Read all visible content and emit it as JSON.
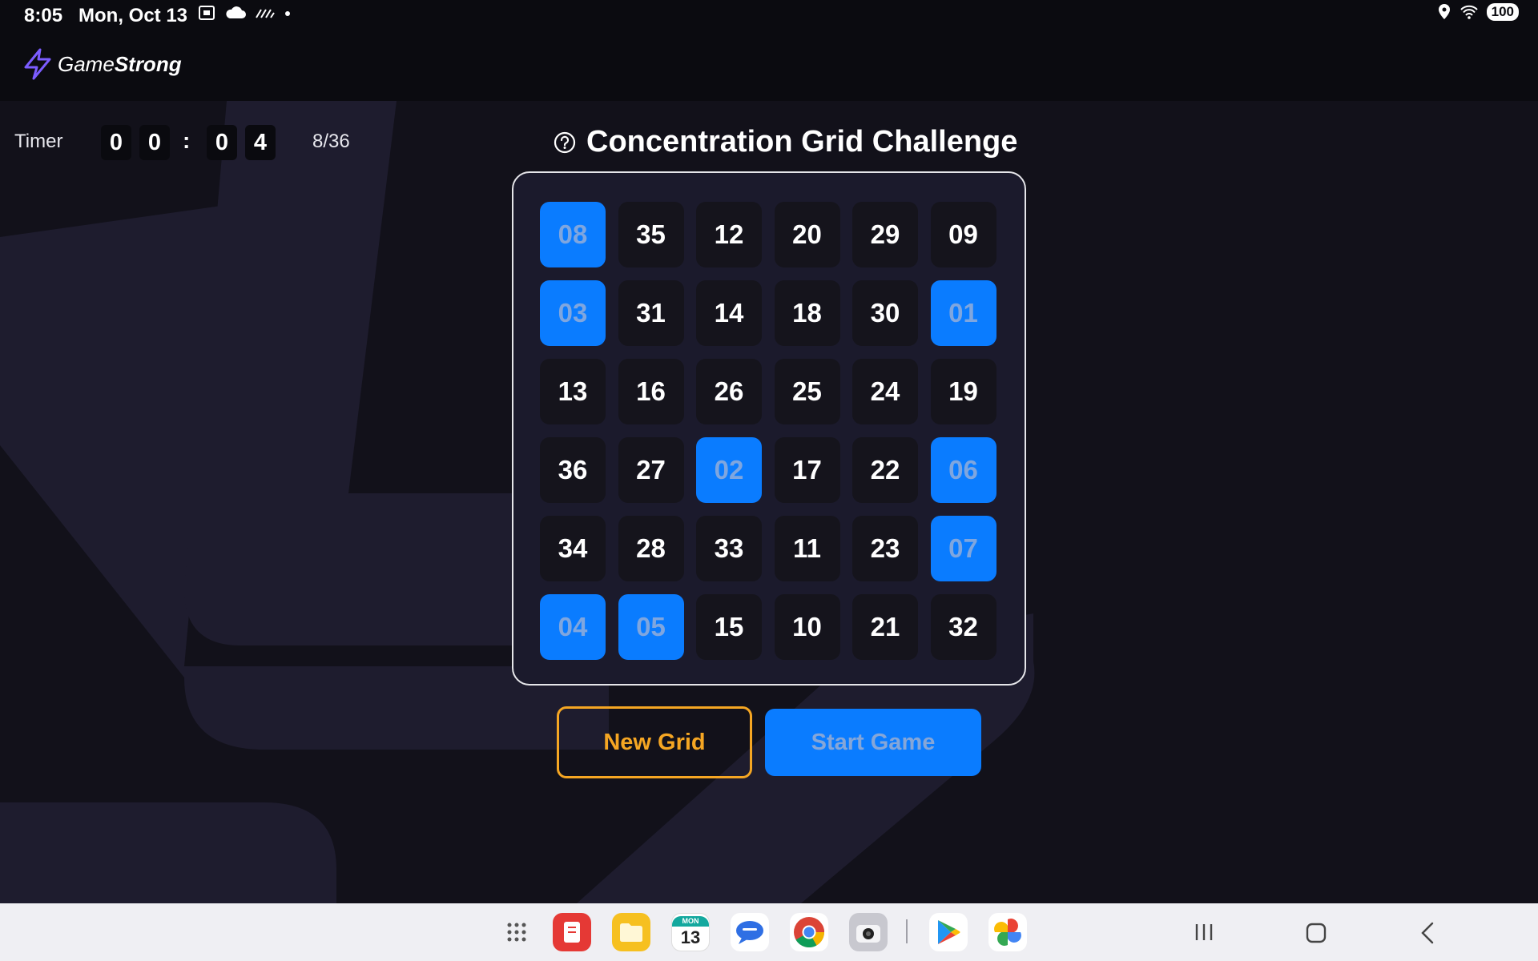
{
  "status_bar": {
    "time": "8:05",
    "date": "Mon, Oct 13",
    "battery": "100"
  },
  "app": {
    "logo_text_1": "Game",
    "logo_text_2": "Strong"
  },
  "timer": {
    "label": "Timer",
    "digits": [
      "0",
      "0",
      "0",
      "4"
    ],
    "separator": ":",
    "progress": "8/36"
  },
  "title": "Concentration Grid Challenge",
  "grid": {
    "cells": [
      {
        "n": "08",
        "sel": true
      },
      {
        "n": "35",
        "sel": false
      },
      {
        "n": "12",
        "sel": false
      },
      {
        "n": "20",
        "sel": false
      },
      {
        "n": "29",
        "sel": false
      },
      {
        "n": "09",
        "sel": false
      },
      {
        "n": "03",
        "sel": true
      },
      {
        "n": "31",
        "sel": false
      },
      {
        "n": "14",
        "sel": false
      },
      {
        "n": "18",
        "sel": false
      },
      {
        "n": "30",
        "sel": false
      },
      {
        "n": "01",
        "sel": true
      },
      {
        "n": "13",
        "sel": false
      },
      {
        "n": "16",
        "sel": false
      },
      {
        "n": "26",
        "sel": false
      },
      {
        "n": "25",
        "sel": false
      },
      {
        "n": "24",
        "sel": false
      },
      {
        "n": "19",
        "sel": false
      },
      {
        "n": "36",
        "sel": false
      },
      {
        "n": "27",
        "sel": false
      },
      {
        "n": "02",
        "sel": true
      },
      {
        "n": "17",
        "sel": false
      },
      {
        "n": "22",
        "sel": false
      },
      {
        "n": "06",
        "sel": true
      },
      {
        "n": "34",
        "sel": false
      },
      {
        "n": "28",
        "sel": false
      },
      {
        "n": "33",
        "sel": false
      },
      {
        "n": "11",
        "sel": false
      },
      {
        "n": "23",
        "sel": false
      },
      {
        "n": "07",
        "sel": true
      },
      {
        "n": "04",
        "sel": true
      },
      {
        "n": "05",
        "sel": true
      },
      {
        "n": "15",
        "sel": false
      },
      {
        "n": "10",
        "sel": false
      },
      {
        "n": "21",
        "sel": false
      },
      {
        "n": "32",
        "sel": false
      }
    ]
  },
  "buttons": {
    "new_grid": "New Grid",
    "start_game": "Start Game"
  },
  "taskbar": {
    "calendar_day": "13",
    "calendar_month": "MON",
    "apps": [
      "app-drawer-icon",
      "notes-app-icon",
      "files-app-icon",
      "calendar-app-icon",
      "messages-app-icon",
      "chrome-app-icon",
      "camera-app-icon",
      "play-store-icon",
      "photos-app-icon"
    ]
  },
  "colors": {
    "accent": "#0a7cff",
    "orange": "#f5a623",
    "background": "#12111a"
  }
}
